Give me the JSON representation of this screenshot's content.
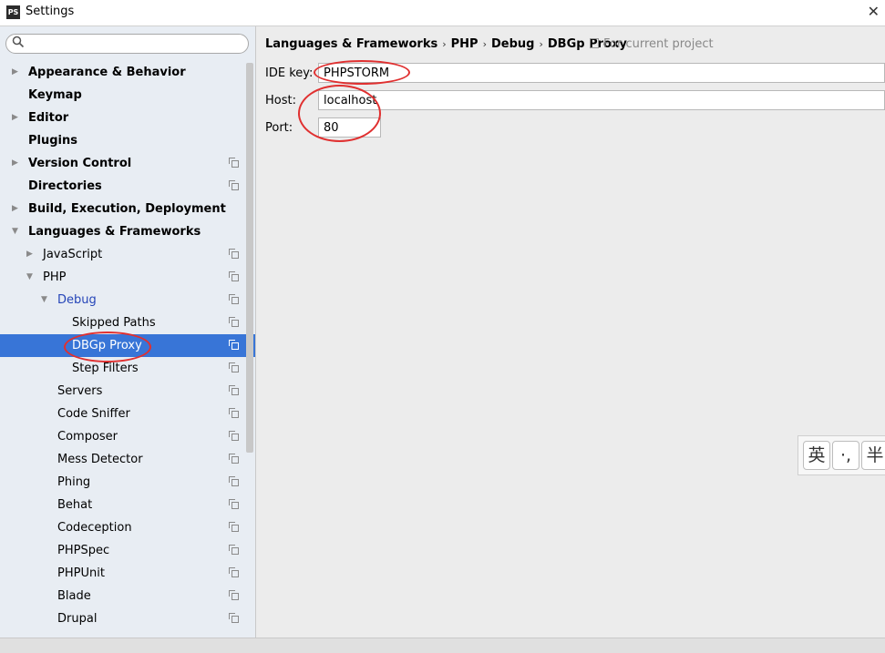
{
  "window": {
    "title": "Settings",
    "app_icon_text": "PS",
    "close_glyph": "✕"
  },
  "search": {
    "placeholder": ""
  },
  "tree": [
    {
      "label": "Appearance & Behavior",
      "level": 0,
      "expander": "collapsed",
      "bold": true,
      "project_icon": false,
      "name": "appearance-behavior"
    },
    {
      "label": "Keymap",
      "level": 0,
      "expander": "none",
      "bold": true,
      "project_icon": false,
      "name": "keymap"
    },
    {
      "label": "Editor",
      "level": 0,
      "expander": "collapsed",
      "bold": true,
      "project_icon": false,
      "name": "editor"
    },
    {
      "label": "Plugins",
      "level": 0,
      "expander": "none",
      "bold": true,
      "project_icon": false,
      "name": "plugins"
    },
    {
      "label": "Version Control",
      "level": 0,
      "expander": "collapsed",
      "bold": true,
      "project_icon": true,
      "name": "version-control"
    },
    {
      "label": "Directories",
      "level": 0,
      "expander": "none",
      "bold": true,
      "project_icon": true,
      "name": "directories"
    },
    {
      "label": "Build, Execution, Deployment",
      "level": 0,
      "expander": "collapsed",
      "bold": true,
      "project_icon": false,
      "name": "build-execution-deployment"
    },
    {
      "label": "Languages & Frameworks",
      "level": 0,
      "expander": "expanded",
      "bold": true,
      "project_icon": false,
      "name": "languages-frameworks"
    },
    {
      "label": "JavaScript",
      "level": 1,
      "expander": "collapsed",
      "bold": false,
      "project_icon": true,
      "name": "javascript"
    },
    {
      "label": "PHP",
      "level": 1,
      "expander": "expanded",
      "bold": false,
      "project_icon": true,
      "name": "php"
    },
    {
      "label": "Debug",
      "level": 2,
      "expander": "expanded",
      "bold": false,
      "project_icon": true,
      "name": "debug",
      "highlight": true
    },
    {
      "label": "Skipped Paths",
      "level": 3,
      "expander": "none",
      "bold": false,
      "project_icon": true,
      "name": "skipped-paths"
    },
    {
      "label": "DBGp Proxy",
      "level": 3,
      "expander": "none",
      "bold": false,
      "project_icon": true,
      "name": "dbgp-proxy",
      "selected": true
    },
    {
      "label": "Step Filters",
      "level": 3,
      "expander": "none",
      "bold": false,
      "project_icon": true,
      "name": "step-filters"
    },
    {
      "label": "Servers",
      "level": 2,
      "expander": "none",
      "bold": false,
      "project_icon": true,
      "name": "servers"
    },
    {
      "label": "Code Sniffer",
      "level": 2,
      "expander": "none",
      "bold": false,
      "project_icon": true,
      "name": "code-sniffer"
    },
    {
      "label": "Composer",
      "level": 2,
      "expander": "none",
      "bold": false,
      "project_icon": true,
      "name": "composer"
    },
    {
      "label": "Mess Detector",
      "level": 2,
      "expander": "none",
      "bold": false,
      "project_icon": true,
      "name": "mess-detector"
    },
    {
      "label": "Phing",
      "level": 2,
      "expander": "none",
      "bold": false,
      "project_icon": true,
      "name": "phing"
    },
    {
      "label": "Behat",
      "level": 2,
      "expander": "none",
      "bold": false,
      "project_icon": true,
      "name": "behat"
    },
    {
      "label": "Codeception",
      "level": 2,
      "expander": "none",
      "bold": false,
      "project_icon": true,
      "name": "codeception"
    },
    {
      "label": "PHPSpec",
      "level": 2,
      "expander": "none",
      "bold": false,
      "project_icon": true,
      "name": "phpspec"
    },
    {
      "label": "PHPUnit",
      "level": 2,
      "expander": "none",
      "bold": false,
      "project_icon": true,
      "name": "phpunit"
    },
    {
      "label": "Blade",
      "level": 2,
      "expander": "none",
      "bold": false,
      "project_icon": true,
      "name": "blade"
    },
    {
      "label": "Drupal",
      "level": 2,
      "expander": "none",
      "bold": false,
      "project_icon": true,
      "name": "drupal"
    }
  ],
  "breadcrumb": {
    "items": [
      "Languages & Frameworks",
      "PHP",
      "Debug",
      "DBGp Proxy"
    ],
    "separator": "›",
    "scope_text": "For current project"
  },
  "form": {
    "ide_key_label": "IDE key:",
    "ide_key_value": "PHPSTORM",
    "host_label": "Host:",
    "host_value": "localhost",
    "port_label": "Port:",
    "port_value": "80"
  },
  "ime": {
    "keys": [
      "英",
      "·,",
      "半"
    ]
  },
  "colors": {
    "selection": "#3875d7",
    "annotation": "#e03030",
    "sidebar_bg": "#e8edf3"
  }
}
